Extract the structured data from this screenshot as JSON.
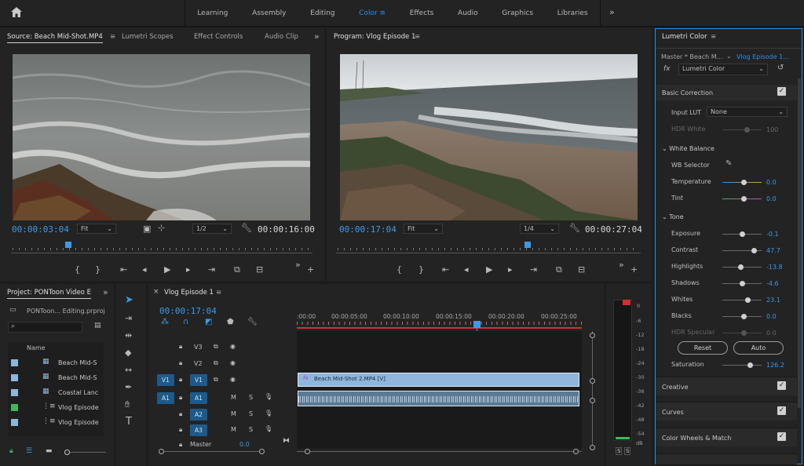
{
  "workspaces": [
    "Learning",
    "Assembly",
    "Editing",
    "Color",
    "Effects",
    "Audio",
    "Graphics",
    "Libraries"
  ],
  "active_workspace": "Color",
  "source": {
    "tabs": [
      "Source: Beach Mid-Shot.MP4",
      "Lumetri Scopes",
      "Effect Controls",
      "Audio Clip"
    ],
    "timecode": "00:00:03:04",
    "fit": "Fit",
    "resolution": "1/2",
    "duration": "00:00:16:00"
  },
  "program": {
    "title": "Program: Vlog Episode 1",
    "timecode": "00:00:17:04",
    "fit": "Fit",
    "resolution": "1/4",
    "duration": "00:00:27:04"
  },
  "project": {
    "title": "Project: PONToon Video E",
    "file": "PONToon... Editing.prproj",
    "column": "Name",
    "items": [
      "Beach Mid-S",
      "Beach Mid-S",
      "Coastal Lanc",
      "Vlog Episode",
      "Vlog Episode"
    ]
  },
  "timeline": {
    "title": "Vlog Episode 1",
    "timecode": "00:00:17:04",
    "ruler": [
      ":00:00",
      "00:00:05:00",
      "00:00:10:00",
      "00:00:15:00",
      "00:00:20:00",
      "00:00:25:00"
    ],
    "tracks": [
      "V3",
      "V2",
      "V1",
      "A1",
      "A2",
      "A3"
    ],
    "v1_label": "V1",
    "a1_label": "A1",
    "mute": "M",
    "solo": "S",
    "clip_name": "Beach Mid-Shot 2.MP4 [V]",
    "master": "Master",
    "master_value": "0.0"
  },
  "meter": {
    "labels": [
      "0",
      "-6",
      "-12",
      "-18",
      "-24",
      "-30",
      "-36",
      "-42",
      "-48",
      "-54",
      "dB"
    ],
    "solo": [
      "S",
      "S"
    ]
  },
  "lumetri": {
    "title": "Lumetri Color",
    "master_clip": "Master * Beach M...",
    "sequence_clip": "Vlog Episode 1...",
    "effect": "Lumetri Color",
    "basic_correction": "Basic Correction",
    "input_lut_label": "Input LUT",
    "input_lut": "None",
    "hdr_white": "HDR White",
    "hdr_white_value": "100",
    "white_balance": "White Balance",
    "wb_selector": "WB Selector",
    "temperature": "Temperature",
    "temperature_value": "0.0",
    "tint": "Tint",
    "tint_value": "0.0",
    "tone": "Tone",
    "exposure": "Exposure",
    "exposure_value": "-0.1",
    "contrast": "Contrast",
    "contrast_value": "47.7",
    "highlights": "Highlights",
    "highlights_value": "-13.8",
    "shadows": "Shadows",
    "shadows_value": "-4.6",
    "whites": "Whites",
    "whites_value": "23.1",
    "blacks": "Blacks",
    "blacks_value": "0.0",
    "hdr_specular": "HDR Specular",
    "hdr_specular_value": "0.0",
    "reset": "Reset",
    "auto": "Auto",
    "saturation": "Saturation",
    "saturation_value": "126.2",
    "creative": "Creative",
    "curves": "Curves",
    "color_wheels": "Color Wheels & Match"
  },
  "colors": {
    "accent": "#2d8ceb",
    "track_blue": "#1d5a8a",
    "clip_blue": "#8fb6dc",
    "playhead": "#3a9ae8",
    "work_area": "#d13030"
  }
}
